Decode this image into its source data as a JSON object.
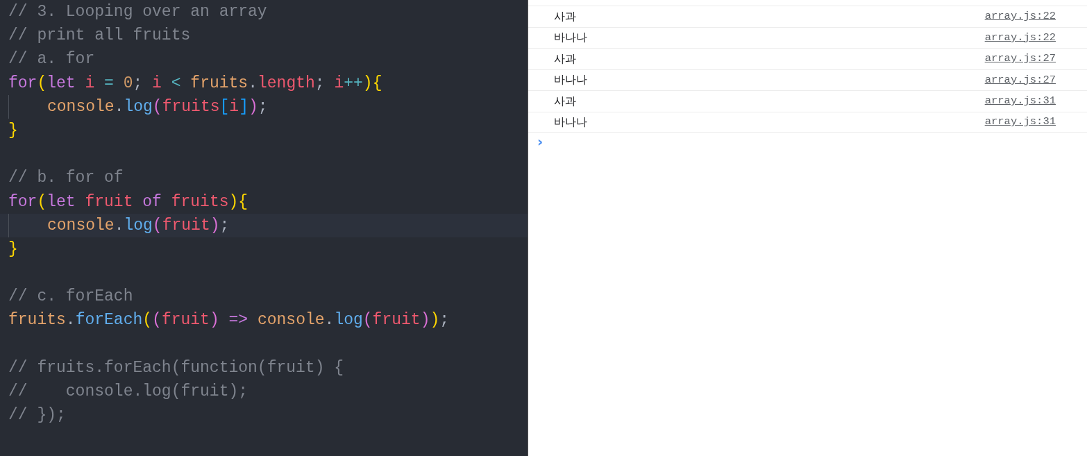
{
  "editor": {
    "lines": [
      {
        "kind": "code",
        "tokens": [
          {
            "kind": "comment",
            "text": "// 3. Looping over an array"
          }
        ]
      },
      {
        "kind": "code",
        "tokens": [
          {
            "kind": "comment",
            "text": "// print all fruits"
          }
        ]
      },
      {
        "kind": "code",
        "tokens": [
          {
            "kind": "comment",
            "text": "// a. for"
          }
        ]
      },
      {
        "kind": "code",
        "tokens": [
          {
            "kind": "keyword",
            "text": "for"
          },
          {
            "kind": "bracket1",
            "text": "("
          },
          {
            "kind": "keyword",
            "text": "let "
          },
          {
            "kind": "variable",
            "text": "i"
          },
          {
            "kind": "operator",
            "text": " = "
          },
          {
            "kind": "number",
            "text": "0"
          },
          {
            "kind": "punct",
            "text": "; "
          },
          {
            "kind": "variable",
            "text": "i"
          },
          {
            "kind": "operator",
            "text": " < "
          },
          {
            "kind": "object",
            "text": "fruits"
          },
          {
            "kind": "punct",
            "text": "."
          },
          {
            "kind": "variable",
            "text": "length"
          },
          {
            "kind": "punct",
            "text": "; "
          },
          {
            "kind": "variable",
            "text": "i"
          },
          {
            "kind": "operator",
            "text": "++"
          },
          {
            "kind": "bracket1",
            "text": ")"
          },
          {
            "kind": "bracket1",
            "text": "{"
          }
        ]
      },
      {
        "kind": "code",
        "indented": true,
        "tokens": [
          {
            "kind": "object",
            "text": "console"
          },
          {
            "kind": "punct",
            "text": "."
          },
          {
            "kind": "function",
            "text": "log"
          },
          {
            "kind": "bracket2",
            "text": "("
          },
          {
            "kind": "variable",
            "text": "fruits"
          },
          {
            "kind": "bracket3",
            "text": "["
          },
          {
            "kind": "variable",
            "text": "i"
          },
          {
            "kind": "bracket3",
            "text": "]"
          },
          {
            "kind": "bracket2",
            "text": ")"
          },
          {
            "kind": "punct",
            "text": ";"
          }
        ]
      },
      {
        "kind": "code",
        "tokens": [
          {
            "kind": "bracket1",
            "text": "}"
          }
        ]
      },
      {
        "kind": "blank"
      },
      {
        "kind": "code",
        "tokens": [
          {
            "kind": "comment",
            "text": "// b. for of"
          }
        ]
      },
      {
        "kind": "code",
        "tokens": [
          {
            "kind": "keyword",
            "text": "for"
          },
          {
            "kind": "bracket1",
            "text": "("
          },
          {
            "kind": "keyword",
            "text": "let "
          },
          {
            "kind": "variable",
            "text": "fruit"
          },
          {
            "kind": "keyword",
            "text": " of "
          },
          {
            "kind": "variable",
            "text": "fruits"
          },
          {
            "kind": "bracket1",
            "text": ")"
          },
          {
            "kind": "bracket1",
            "text": "{"
          }
        ]
      },
      {
        "kind": "code",
        "indented": true,
        "current": true,
        "tokens": [
          {
            "kind": "object",
            "text": "console"
          },
          {
            "kind": "punct",
            "text": "."
          },
          {
            "kind": "function",
            "text": "log"
          },
          {
            "kind": "bracket2",
            "text": "("
          },
          {
            "kind": "variable",
            "text": "fruit"
          },
          {
            "kind": "bracket2",
            "text": ")"
          },
          {
            "kind": "punct",
            "text": ";"
          }
        ]
      },
      {
        "kind": "code",
        "tokens": [
          {
            "kind": "bracket1",
            "text": "}"
          }
        ]
      },
      {
        "kind": "blank"
      },
      {
        "kind": "code",
        "tokens": [
          {
            "kind": "comment",
            "text": "// c. forEach"
          }
        ]
      },
      {
        "kind": "code",
        "tokens": [
          {
            "kind": "object",
            "text": "fruits"
          },
          {
            "kind": "punct",
            "text": "."
          },
          {
            "kind": "function",
            "text": "forEach"
          },
          {
            "kind": "bracket1",
            "text": "("
          },
          {
            "kind": "bracket2",
            "text": "("
          },
          {
            "kind": "variable",
            "text": "fruit"
          },
          {
            "kind": "bracket2",
            "text": ")"
          },
          {
            "kind": "keyword",
            "text": " => "
          },
          {
            "kind": "object",
            "text": "console"
          },
          {
            "kind": "punct",
            "text": "."
          },
          {
            "kind": "function",
            "text": "log"
          },
          {
            "kind": "bracket2",
            "text": "("
          },
          {
            "kind": "variable",
            "text": "fruit"
          },
          {
            "kind": "bracket2",
            "text": ")"
          },
          {
            "kind": "bracket1",
            "text": ")"
          },
          {
            "kind": "punct",
            "text": ";"
          }
        ]
      },
      {
        "kind": "blank"
      },
      {
        "kind": "code",
        "tokens": [
          {
            "kind": "comment",
            "text": "// fruits.forEach(function(fruit) {"
          }
        ]
      },
      {
        "kind": "code",
        "tokens": [
          {
            "kind": "comment",
            "text": "//    console.log(fruit);"
          }
        ]
      },
      {
        "kind": "code",
        "tokens": [
          {
            "kind": "comment",
            "text": "// });"
          }
        ]
      }
    ]
  },
  "console": {
    "messages": [
      {
        "text": "사과",
        "source": "array.js:22"
      },
      {
        "text": "바나나",
        "source": "array.js:22"
      },
      {
        "text": "사과",
        "source": "array.js:27"
      },
      {
        "text": "바나나",
        "source": "array.js:27"
      },
      {
        "text": "사과",
        "source": "array.js:31"
      },
      {
        "text": "바나나",
        "source": "array.js:31"
      }
    ],
    "prompt": "›"
  }
}
